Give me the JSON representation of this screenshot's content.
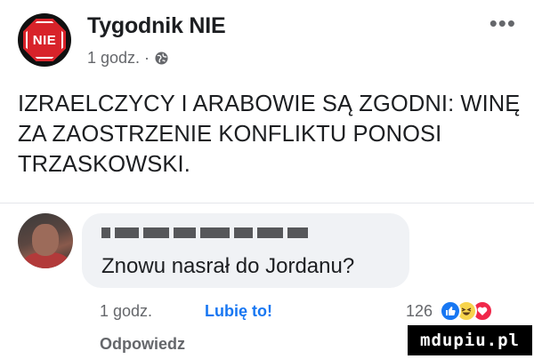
{
  "post": {
    "page_name": "Tygodnik NIE",
    "avatar_text": "NIE",
    "time": "1 godz. ·",
    "text_lines": [
      "IZRAELCZYCY I ARABOWIE SĄ ZGODNI: WINĘ",
      "ZA ZAOSTRZENIE KONFLIKTU PONOSI",
      "TRZASKOWSKI."
    ]
  },
  "comment": {
    "text": "Znowu nasrał do Jordanu?",
    "time": "1 godz.",
    "like_label": "Lubię to!",
    "reaction_count": "126",
    "reactions": [
      "like-icon",
      "haha-icon",
      "love-icon"
    ],
    "reply_label": "Odpowiedz"
  },
  "watermark": "mdupiu.pl",
  "colors": {
    "facebook_blue": "#1877f2",
    "logo_red": "#d8232a",
    "secondary_text": "#65676b",
    "bubble": "#f0f2f5"
  }
}
